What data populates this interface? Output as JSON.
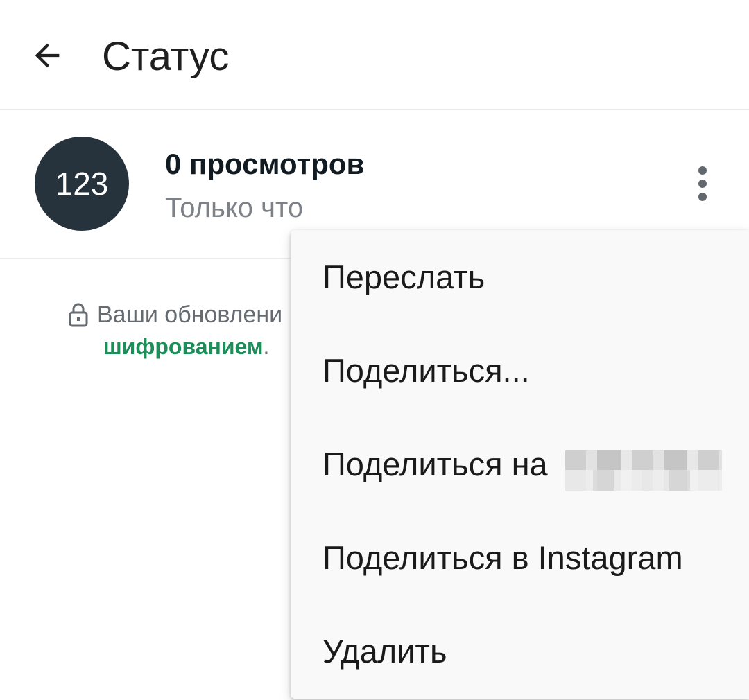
{
  "header": {
    "back_icon": "arrow-left-icon",
    "title": "Статус"
  },
  "status": {
    "avatar_text": "123",
    "avatar_color": "#26333d",
    "views": "0 просмотров",
    "time": "Только что",
    "more_icon": "more-vertical-icon"
  },
  "encryption": {
    "lock_icon": "lock-icon",
    "text": "Ваши обновлени",
    "link": "шифрованием",
    "link_suffix": ".",
    "link_color": "#1e8d5a"
  },
  "menu": {
    "items": [
      {
        "label": "Переслать"
      },
      {
        "label": "Поделиться..."
      },
      {
        "label": "Поделиться на"
      },
      {
        "label": "Поделиться в Instagram"
      },
      {
        "label": "Удалить"
      }
    ]
  }
}
